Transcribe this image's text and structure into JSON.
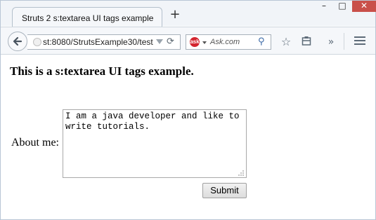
{
  "browser": {
    "tab_title": "Struts 2 s:textarea UI tags example",
    "new_tab_label": "+",
    "window_controls": {
      "minimize": "–",
      "maximize": "□",
      "close": "✕"
    },
    "url_prefix_dim": "",
    "url": "st:8080/StrutsExample30/test",
    "search_placeholder": "Ask.com",
    "search_engine_icon": "ask-icon"
  },
  "page": {
    "title": "This is a s:textarea UI tags example.",
    "about_label": "About me:",
    "textarea_value": "I am a java developer and like to write tutorials.",
    "submit_label": "Submit"
  },
  "colors": {
    "close_button": "#c9504a",
    "chrome_bg": "#f5f7fa",
    "ask_red": "#d3252f"
  }
}
